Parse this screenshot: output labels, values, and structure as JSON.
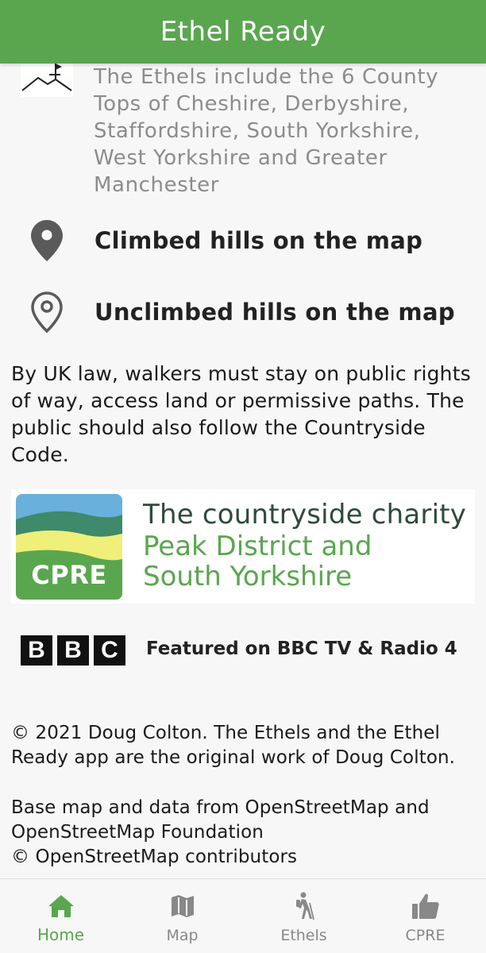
{
  "header": {
    "title": "Ethel Ready"
  },
  "intro": {
    "text": "The Ethels include the 6 County Tops of Cheshire, Derbyshire, Staffordshire, South Yorkshire, West Yorkshire and Greater Manchester"
  },
  "legend": {
    "climbed_label": "Climbed hills on the map",
    "unclimbed_label": "Unclimbed hills on the map",
    "icon_color": "#5a5a5a"
  },
  "law_text": "By UK law, walkers must stay on public rights of way, access land or permissive paths. The public should also follow the Countryside Code.",
  "cpre": {
    "badge": "CPRE",
    "line1": "The countryside charity",
    "line2": "Peak District and",
    "line3": "South Yorkshire"
  },
  "bbc": {
    "letters": [
      "B",
      "B",
      "C"
    ],
    "text": "Featured on BBC TV & Radio 4"
  },
  "footer": {
    "copyright": "© 2021 Doug Colton. The Ethels and the Ethel Ready app are the original work of Doug Colton.",
    "osm_line1": "Base map and data from OpenStreetMap and OpenStreetMap Foundation",
    "osm_line2": "© OpenStreetMap contributors"
  },
  "tabs": [
    {
      "label": "Home",
      "icon": "home-icon",
      "active": true
    },
    {
      "label": "Map",
      "icon": "map-icon",
      "active": false
    },
    {
      "label": "Ethels",
      "icon": "hiker-icon",
      "active": false
    },
    {
      "label": "CPRE",
      "icon": "thumbs-up-icon",
      "active": false
    }
  ],
  "colors": {
    "accent": "#5aa64f",
    "inactive_tab": "#888888",
    "cpre_dark": "#2f4a3c"
  }
}
